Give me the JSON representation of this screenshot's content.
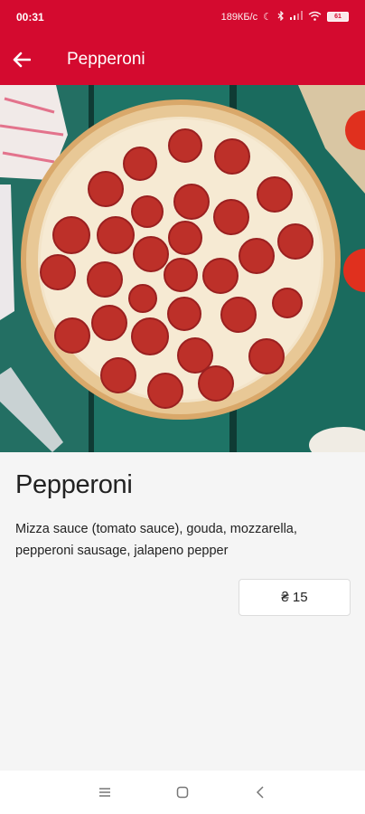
{
  "status_bar": {
    "time": "00:31",
    "speed": "189КБ/с",
    "battery": "61"
  },
  "app_bar": {
    "title": "Pepperoni",
    "back_icon": "arrow-left-icon",
    "color": "#d40a2f"
  },
  "product": {
    "name": "Pepperoni",
    "description": "Mizza sauce (tomato sauce), gouda, mozzarella, pepperoni sausage, jalapeno pepper",
    "price": "₴ 15"
  },
  "nav_bar": {
    "icons": [
      "menu-icon",
      "home-square-icon",
      "back-chevron-icon"
    ]
  }
}
